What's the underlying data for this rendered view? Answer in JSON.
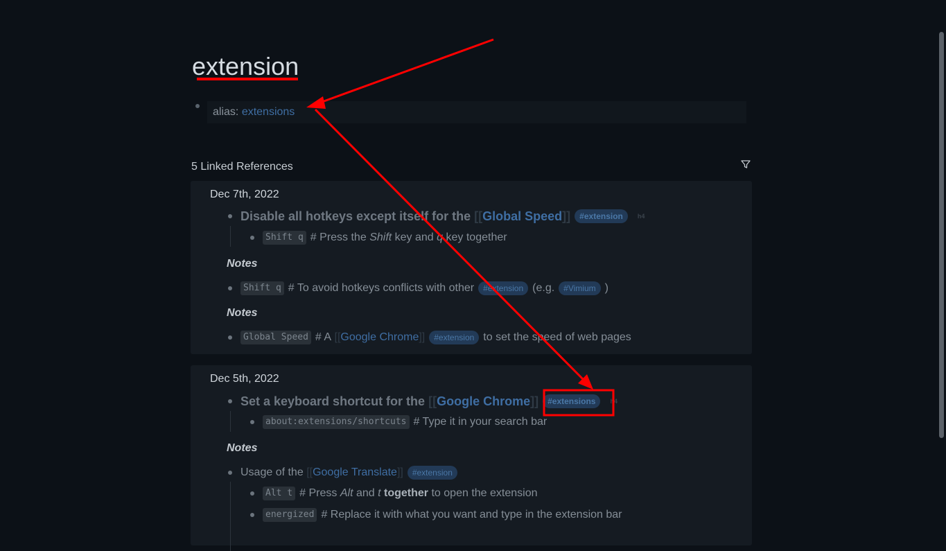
{
  "page": {
    "title": "extension"
  },
  "property": {
    "key": "alias:",
    "value": "extensions"
  },
  "refs": {
    "title": "5 Linked References"
  },
  "card1": {
    "date": "Dec 7th, 2022",
    "heading_prefix": "Disable all hotkeys except itself for the",
    "heading_link": "Global Speed",
    "heading_tag": "#extension",
    "heading_level": "h4",
    "child1_code": "Shift q",
    "child1_pre": "# Press the",
    "child1_em1": "Shift",
    "child1_mid": "key and",
    "child1_em2": "q",
    "child1_post": "key together",
    "notes1": "Notes",
    "note1_code": "Shift q",
    "note1_pre": "# To avoid hotkeys conflicts with other",
    "note1_tag": "#extension",
    "note1_mid": "(e.g.",
    "note1_tag2": "#Vimium",
    "note1_post": ")",
    "notes2": "Notes",
    "note2_code": "Global Speed",
    "note2_pre": "# A",
    "note2_link": "Google Chrome",
    "note2_tag": "#extension",
    "note2_post": "to set the speed of web pages"
  },
  "card2": {
    "date": "Dec 5th, 2022",
    "heading_prefix": "Set a keyboard shortcut for the",
    "heading_link": "Google Chrome",
    "heading_tag": "#extensions",
    "heading_level": "h4",
    "child1_code": "about:extensions/shortcuts",
    "child1_text": "# Type it in your search bar",
    "notes": "Notes",
    "usage_pre": "Usage of the",
    "usage_link": "Google Translate",
    "usage_tag": "#extension",
    "sub1_code": "Alt t",
    "sub1_pre": "# Press",
    "sub1_em1": "Alt",
    "sub1_mid": "and",
    "sub1_em2": "t",
    "sub1_bold": "together",
    "sub1_post": "to open the extension",
    "sub2_code": "energized",
    "sub2_text": "# Replace it with what you want and type in the extension bar"
  },
  "brackets": {
    "open": "[[",
    "close": "]]"
  },
  "icons": {
    "filter": "filter-icon"
  },
  "colors": {
    "annotation": "#ff0000",
    "link": "#3f6ea3",
    "background": "#0c1117"
  }
}
